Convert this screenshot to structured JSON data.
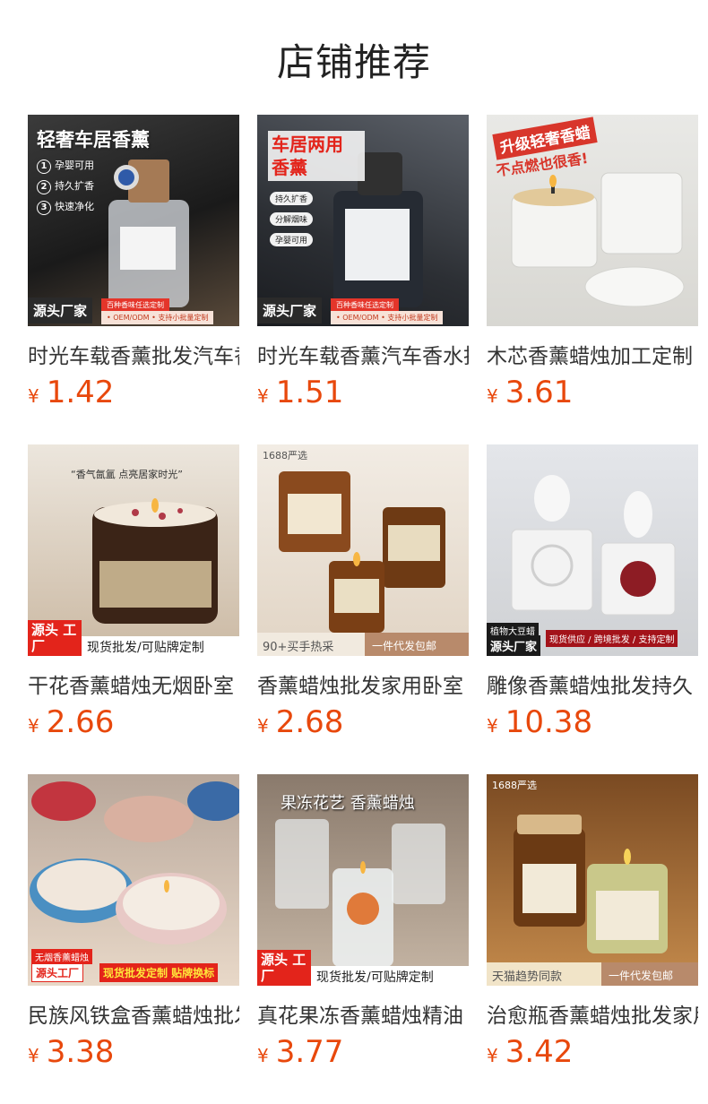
{
  "page": {
    "title": "店铺推荐"
  },
  "products": [
    {
      "name": "时光车载香薰批发汽车香水",
      "currency": "¥",
      "price": "1.42",
      "overlay": {
        "headline": "轻奢车居香薰",
        "features": [
          "孕婴可用",
          "持久扩香",
          "快速净化"
        ],
        "factory": "源头厂家",
        "promo1": "百种香味任选定制",
        "promo2": "• OEM/ODM  • 支持小批量定制"
      }
    },
    {
      "name": "时光车载香薰汽车香水批发",
      "currency": "¥",
      "price": "1.51",
      "overlay": {
        "headline": "车居两用 香薰",
        "features": [
          "持久扩香",
          "分解烟味",
          "孕婴可用"
        ],
        "factory": "源头厂家",
        "promo1": "百种香味任选定制",
        "promo2": "• OEM/ODM  • 支持小批量定制"
      }
    },
    {
      "name": "木芯香薰蜡烛加工定制",
      "currency": "¥",
      "price": "3.61",
      "overlay": {
        "headline": "升级轻奢香蜡",
        "sub": "不点燃也很香!"
      }
    },
    {
      "name": "干花香薰蜡烛无烟卧室",
      "currency": "¥",
      "price": "2.66",
      "overlay": {
        "quote": "“香气氤氲 点亮居家时光”",
        "factory": "源头 工厂",
        "promo": "现货批发/可贴牌定制"
      }
    },
    {
      "name": "香薰蜡烛批发家用卧室",
      "currency": "¥",
      "price": "2.68",
      "overlay": {
        "badge": "1688严选",
        "left": "90+买手热采",
        "right": "一件代发包邮"
      }
    },
    {
      "name": "雕像香薰蜡烛批发持久",
      "currency": "¥",
      "price": "10.38",
      "overlay": {
        "tag1": "植物大豆蜡",
        "factory": "源头厂家",
        "promo": "现货供应 / 跨境批发 / 支持定制"
      }
    },
    {
      "name": "民族风铁盒香薰蜡烛批发",
      "currency": "¥",
      "price": "3.38",
      "overlay": {
        "tag1": "无烟香薰蜡烛",
        "factory": "源头工厂",
        "promo": "现货批发定制 贴牌换标"
      }
    },
    {
      "name": "真花果冻香薰蜡烛精油",
      "currency": "¥",
      "price": "3.77",
      "overlay": {
        "headline": "果冻花艺  香薰蜡烛",
        "factory": "源头 工厂",
        "promo": "现货批发/可贴牌定制"
      }
    },
    {
      "name": "治愈瓶香薰蜡烛批发家用",
      "currency": "¥",
      "price": "3.42",
      "overlay": {
        "badge": "1688严选",
        "left": "天猫趋势同款",
        "right": "一件代发包邮"
      }
    }
  ]
}
